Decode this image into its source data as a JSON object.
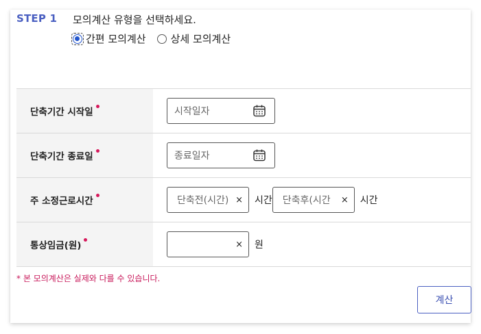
{
  "step": {
    "label": "STEP 1",
    "question": "모의계산 유형을 선택하세요."
  },
  "calc_type": {
    "options": [
      {
        "label": "간편 모의계산",
        "selected": true
      },
      {
        "label": "상세 모의계산",
        "selected": false
      }
    ]
  },
  "form": {
    "rows": [
      {
        "label": "단축기간 시작일",
        "placeholder": "시작일자"
      },
      {
        "label": "단축기간 종료일",
        "placeholder": "종료일자"
      },
      {
        "label": "주 소정근로시간",
        "before_placeholder": "단축전(시간)",
        "before_unit": "시간",
        "after_placeholder": "단축후(시간",
        "after_unit": "시간"
      },
      {
        "label": "통상임금(원)",
        "value": "",
        "unit": "원"
      }
    ],
    "clear_symbol": "×"
  },
  "notice": "* 본 모의계산은 실제와 다를 수 있습니다.",
  "calculate_button": "계산",
  "colors": {
    "accent": "#4a5fc1",
    "required": "#d6185b",
    "notice": "#c8185a",
    "label_bg": "#f4f4f4"
  },
  "icons": {
    "date": "calendar-icon",
    "clear": "clear-icon"
  }
}
